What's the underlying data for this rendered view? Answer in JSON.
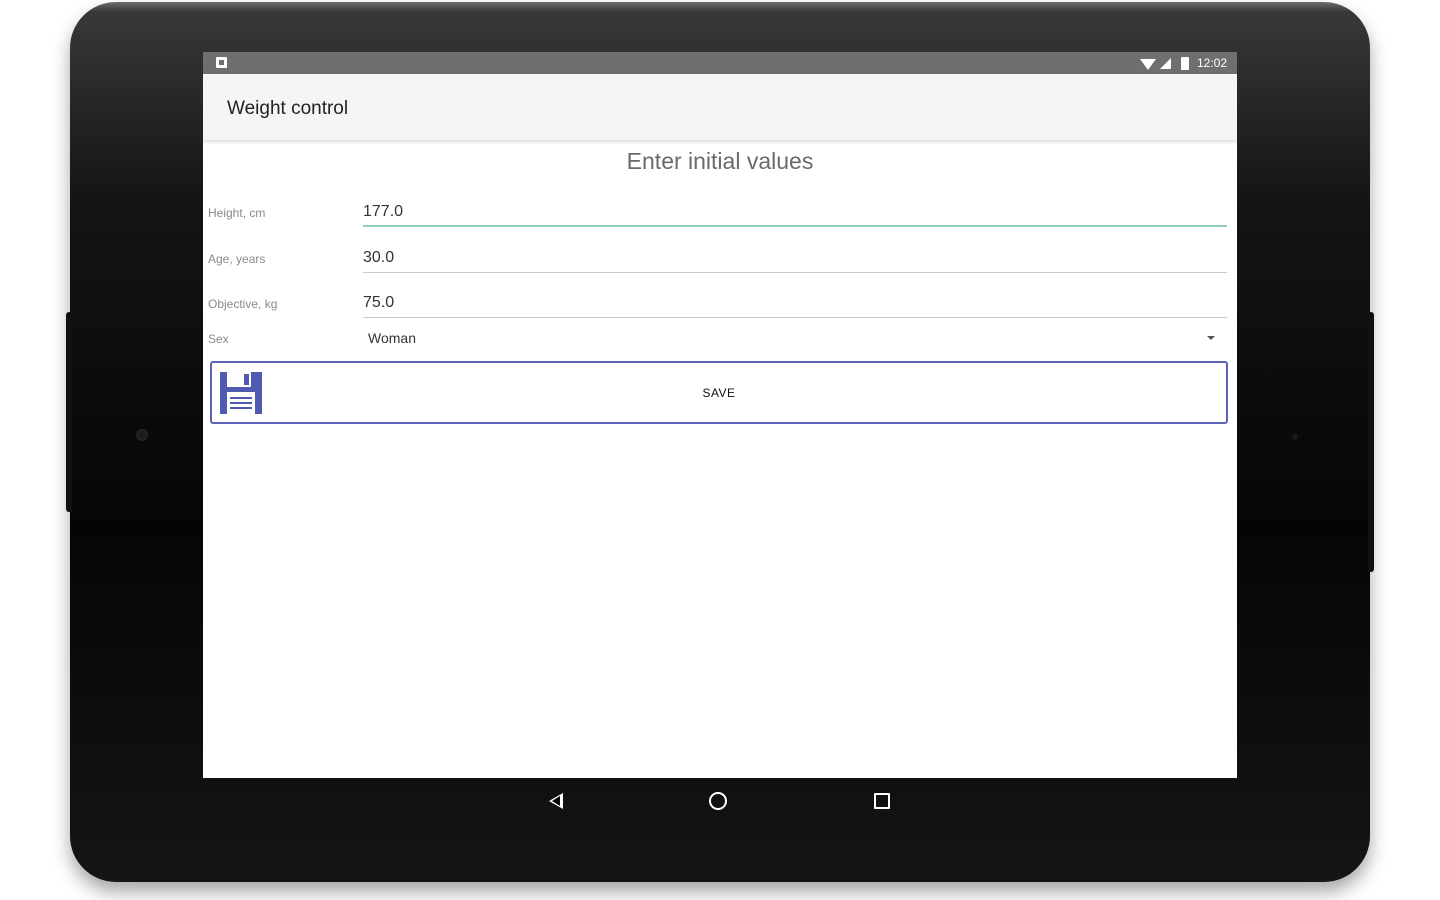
{
  "status_bar": {
    "time": "12:02",
    "icons": [
      "notification-icon",
      "wifi-icon",
      "signal-icon",
      "battery-icon"
    ]
  },
  "app_bar": {
    "title": "Weight control"
  },
  "form": {
    "heading": "Enter initial values",
    "height": {
      "label": "Height, cm",
      "value": "177.0"
    },
    "age": {
      "label": "Age, years",
      "value": "30.0"
    },
    "objective": {
      "label": "Objective, kg",
      "value": "75.0"
    },
    "sex": {
      "label": "Sex",
      "value": "Woman"
    },
    "save": {
      "label": "SAVE",
      "icon": "floppy-disk-icon"
    }
  },
  "nav_bar": {
    "icons": [
      "back-icon",
      "home-icon",
      "recent-apps-icon"
    ]
  },
  "colors": {
    "accent_active_field": "#8fcfbf",
    "save_button_border": "#5b63b7",
    "status_bar": "#6f6f6f"
  }
}
